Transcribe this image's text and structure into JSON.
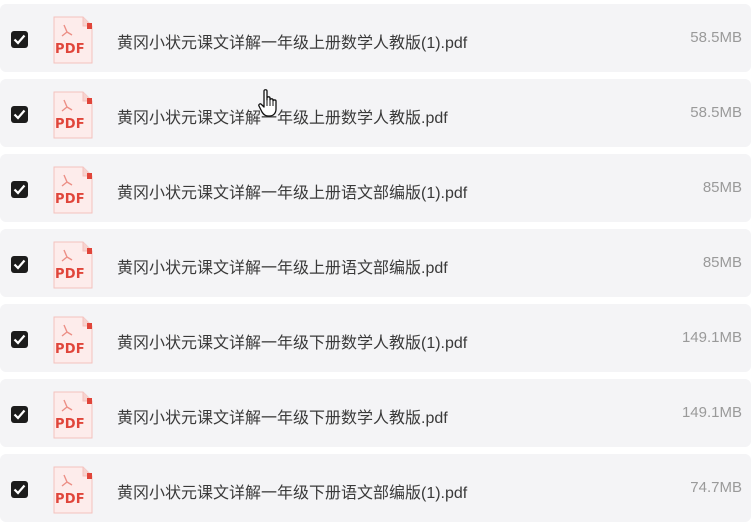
{
  "files": [
    {
      "name": "黄冈小状元课文详解一年级上册数学人教版(1).pdf",
      "size": "58.5MB",
      "checked": true,
      "icon_text": "PDF"
    },
    {
      "name": "黄冈小状元课文详解一年级上册数学人教版.pdf",
      "size": "58.5MB",
      "checked": true,
      "icon_text": "PDF"
    },
    {
      "name": "黄冈小状元课文详解一年级上册语文部编版(1).pdf",
      "size": "85MB",
      "checked": true,
      "icon_text": "PDF"
    },
    {
      "name": "黄冈小状元课文详解一年级上册语文部编版.pdf",
      "size": "85MB",
      "checked": true,
      "icon_text": "PDF"
    },
    {
      "name": "黄冈小状元课文详解一年级下册数学人教版(1).pdf",
      "size": "149.1MB",
      "checked": true,
      "icon_text": "PDF"
    },
    {
      "name": "黄冈小状元课文详解一年级下册数学人教版.pdf",
      "size": "149.1MB",
      "checked": true,
      "icon_text": "PDF"
    },
    {
      "name": "黄冈小状元课文详解一年级下册语文部编版(1).pdf",
      "size": "74.7MB",
      "checked": true,
      "icon_text": "PDF"
    }
  ],
  "icons": {
    "file": "pdf-file-icon",
    "check": "checkmark-icon",
    "cursor": "hand-pointer-icon"
  },
  "colors": {
    "row_bg": "#f4f4f6",
    "checkbox": "#1c1c1c",
    "pdf_red": "#e0453a",
    "text": "#3a3a3a",
    "size_text": "#9a9a9a"
  }
}
